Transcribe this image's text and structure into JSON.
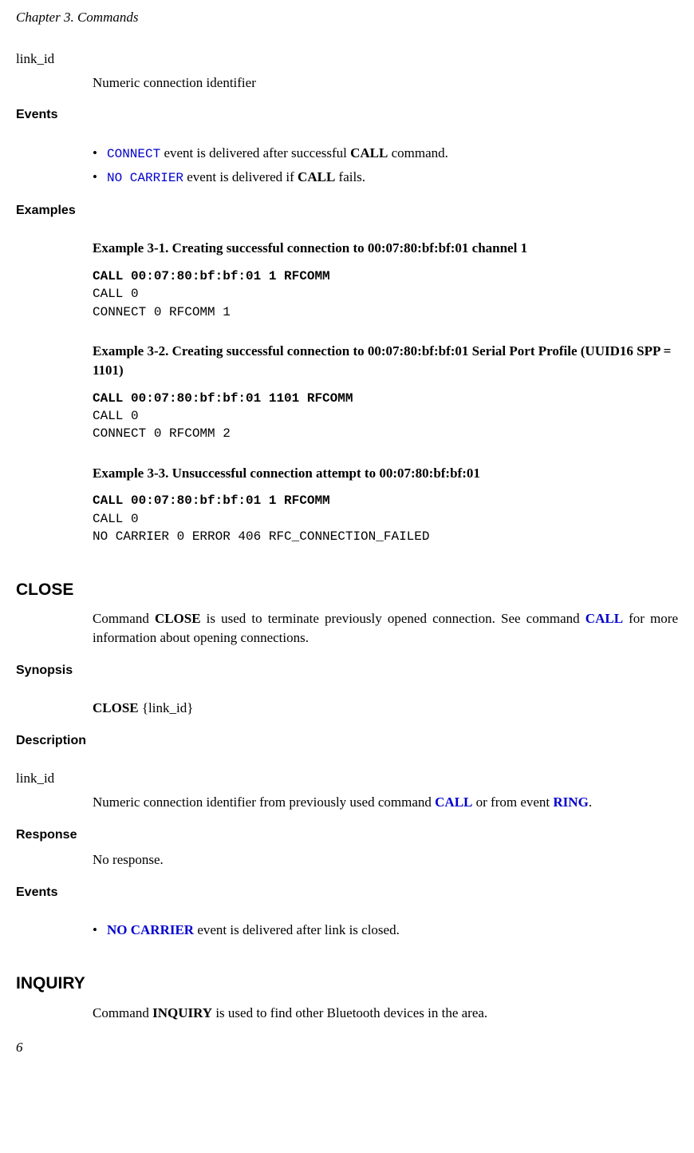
{
  "chapterHeader": "Chapter 3. Commands",
  "linkIdTerm": "link_id",
  "linkIdDef": "Numeric connection identifier",
  "eventsLabel": "Events",
  "examplesLabel": "Examples",
  "synopsisLabel": "Synopsis",
  "descriptionLabel": "Description",
  "responseLabel": "Response",
  "bullets1": {
    "connectLink": "CONNECT",
    "connectRest": " event is delivered after successful ",
    "connectBold": "CALL",
    "connectEnd": " command.",
    "nocarrierLink": "NO CARRIER",
    "nocarrierRest": " event is delivered if ",
    "nocarrierBold": "CALL",
    "nocarrierEnd": " fails."
  },
  "ex1": {
    "title": "Example 3-1. Creating successful connection to 00:07:80:bf:bf:01 channel 1",
    "line1": "CALL 00:07:80:bf:bf:01 1 RFCOMM",
    "line2": "CALL 0",
    "line3": "CONNECT 0 RFCOMM 1"
  },
  "ex2": {
    "title": "Example 3-2. Creating successful connection to 00:07:80:bf:bf:01 Serial Port Profile (UUID16 SPP = 1101)",
    "line1": "CALL 00:07:80:bf:bf:01 1101 RFCOMM",
    "line2": "CALL 0",
    "line3": "CONNECT 0 RFCOMM 2"
  },
  "ex3": {
    "title": "Example 3-3. Unsuccessful connection attempt to 00:07:80:bf:bf:01",
    "line1": "CALL 00:07:80:bf:bf:01 1 RFCOMM",
    "line2": "CALL 0",
    "line3": "NO CARRIER 0 ERROR 406 RFC_CONNECTION_FAILED"
  },
  "close": {
    "heading": "CLOSE",
    "body1a": "Command ",
    "body1b": "CLOSE",
    "body1c": " is used to terminate previously opened connection. See command ",
    "body1link": "CALL",
    "body1d": " for more information about opening connections.",
    "synopsis1": "CLOSE",
    "synopsis2": " {link_id}",
    "descTerm": "link_id",
    "descText1": "Numeric connection identifier from previously used command ",
    "descLink1": "CALL",
    "descText2": " or from event ",
    "descLink2": "RING",
    "descText3": ".",
    "responseText": "No response.",
    "eventLink": "NO CARRIER",
    "eventRest": " event is delivered after link is closed."
  },
  "inquiry": {
    "heading": "INQUIRY",
    "body1a": "Command ",
    "body1b": "INQUIRY",
    "body1c": " is used to find other Bluetooth devices in the area."
  },
  "pageNum": "6"
}
